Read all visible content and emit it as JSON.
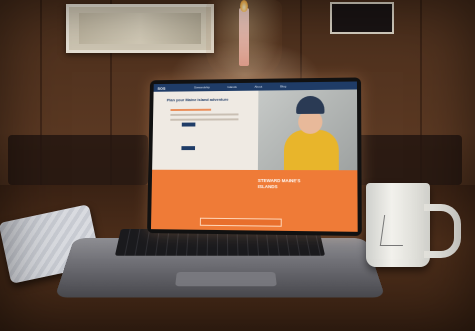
{
  "website": {
    "logo": "SOS",
    "nav": [
      "Stewardship",
      "Islands",
      "About",
      "Blog"
    ],
    "hero_title": "Plan your Maine island adventure",
    "hero_buttons": [
      "",
      ""
    ],
    "footer_links": [
      "",
      "",
      ""
    ],
    "footer_title": "STEWARD MAINE'S ISLANDS",
    "footer_bar": [
      "",
      "",
      "",
      ""
    ]
  }
}
